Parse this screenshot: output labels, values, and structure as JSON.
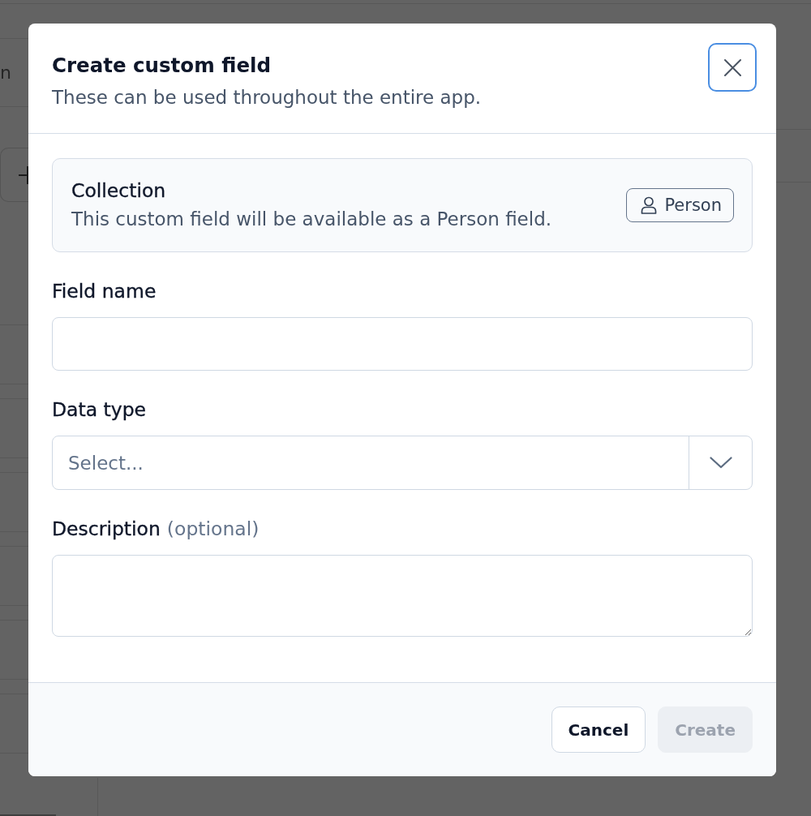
{
  "backdrop": {
    "partial_text": "n"
  },
  "dialog": {
    "title": "Create custom field",
    "subtitle": "These can be used throughout the entire app.",
    "close_button": {
      "focused": true
    }
  },
  "collection": {
    "title": "Collection",
    "description": "This custom field will be available as a Person field.",
    "tag": {
      "label": "Person"
    }
  },
  "fields": [
    {
      "kind": "text",
      "label": "Field name"
    },
    {
      "kind": "select",
      "label": "Data type",
      "placeholder": "Select..."
    },
    {
      "kind": "textarea",
      "label": "Description",
      "hint": "(optional)"
    }
  ],
  "footer": {
    "buttons": [
      {
        "kind": "secondary",
        "label": "Cancel",
        "disabled": false
      },
      {
        "kind": "primary",
        "label": "Create",
        "disabled": true
      }
    ]
  }
}
